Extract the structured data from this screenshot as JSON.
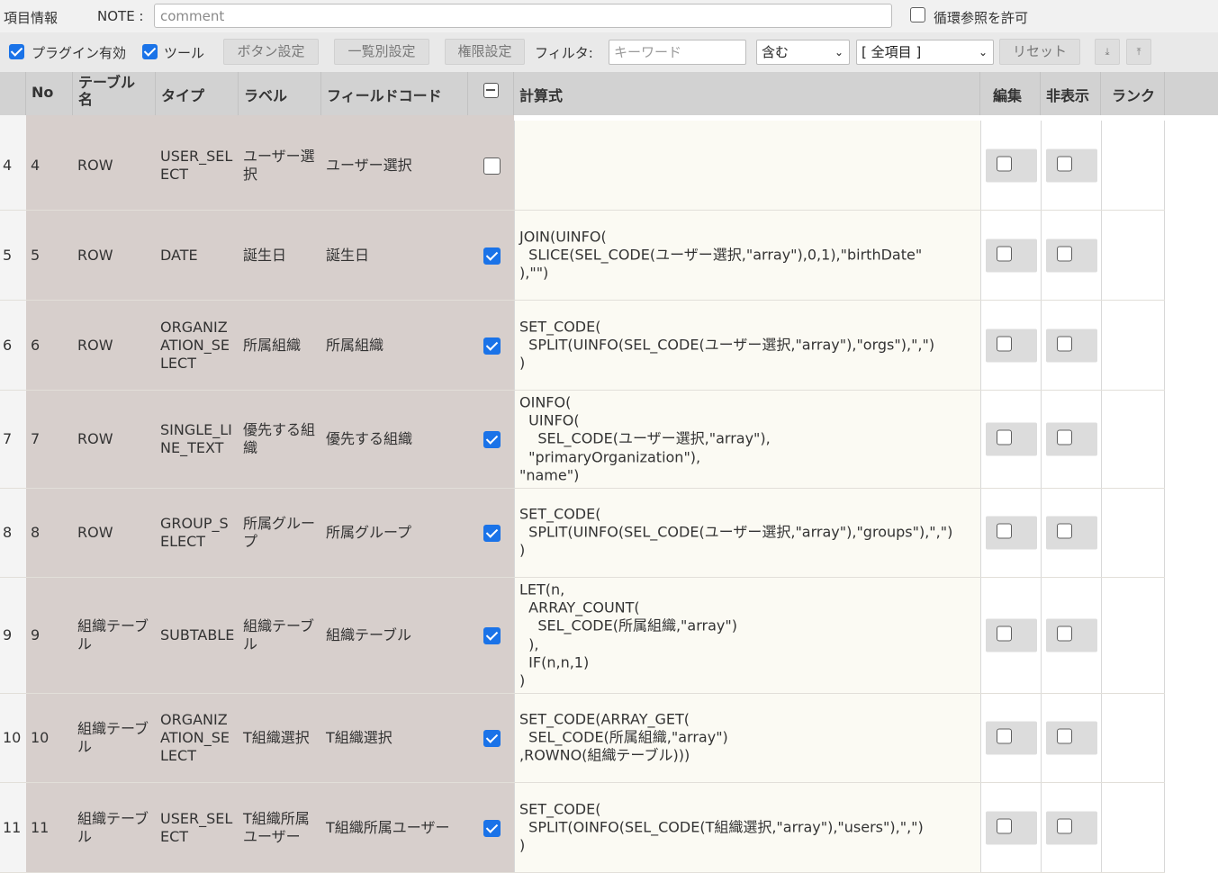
{
  "header": {
    "item_info_label": "項目情報",
    "note_label": "NOTE :",
    "note_placeholder": "comment",
    "circular_ref_label": "循環参照を許可",
    "circular_ref_checked": false
  },
  "toolbar": {
    "plugin_enabled_label": "プラグイン有効",
    "plugin_enabled_checked": true,
    "tools_label": "ツール",
    "tools_checked": true,
    "button_settings": "ボタン設定",
    "list_settings": "一覧別設定",
    "permission_settings": "権限設定",
    "filter_label": "フィルタ:",
    "keyword_placeholder": "キーワード",
    "match_select": "含む",
    "field_select": "[ 全項目 ]",
    "reset": "リセット",
    "icon_download": "download-icon",
    "icon_upload": "upload-icon"
  },
  "columns": {
    "no": "No",
    "table": "テーブル名",
    "table_l1": "テーブル",
    "table_l2": "名",
    "type": "タイプ",
    "label": "ラベル",
    "field_code": "フィールドコード",
    "formula": "計算式",
    "edit": "編集",
    "hidden": "非表示",
    "rank": "ランク"
  },
  "rows": [
    {
      "idx": "4",
      "no": "4",
      "table": "ROW",
      "type": "USER_SELECT",
      "label": "ユーザー選択",
      "field": "ユーザー選択",
      "calc": false,
      "formula": "",
      "edit": false,
      "hidden": false
    },
    {
      "idx": "5",
      "no": "5",
      "table": "ROW",
      "type": "DATE",
      "label": "誕生日",
      "field": "誕生日",
      "calc": true,
      "formula": "JOIN(UINFO(\n  SLICE(SEL_CODE(ユーザー選択,\"array\"),0,1),\"birthDate\"\n),\"\")",
      "edit": false,
      "hidden": false
    },
    {
      "idx": "6",
      "no": "6",
      "table": "ROW",
      "type": "ORGANIZATION_SELECT",
      "label": "所属組織",
      "field": "所属組織",
      "calc": true,
      "formula": "SET_CODE(\n  SPLIT(UINFO(SEL_CODE(ユーザー選択,\"array\"),\"orgs\"),\",\")\n)",
      "edit": false,
      "hidden": false
    },
    {
      "idx": "7",
      "no": "7",
      "table": "ROW",
      "type": "SINGLE_LINE_TEXT",
      "label": "優先する組織",
      "field": "優先する組織",
      "calc": true,
      "formula": "OINFO(\n  UINFO(\n    SEL_CODE(ユーザー選択,\"array\"),\n  \"primaryOrganization\"),\n\"name\")",
      "edit": false,
      "hidden": false
    },
    {
      "idx": "8",
      "no": "8",
      "table": "ROW",
      "type": "GROUP_SELECT",
      "label": "所属グループ",
      "field": "所属グループ",
      "calc": true,
      "formula": "SET_CODE(\n  SPLIT(UINFO(SEL_CODE(ユーザー選択,\"array\"),\"groups\"),\",\")\n)",
      "edit": false,
      "hidden": false
    },
    {
      "idx": "9",
      "no": "9",
      "table": "組織テーブル",
      "type": "SUBTABLE",
      "label": "組織テーブル",
      "field": "組織テーブル",
      "calc": true,
      "formula": "LET(n,\n  ARRAY_COUNT(\n    SEL_CODE(所属組織,\"array\")\n  ),\n  IF(n,n,1)\n)",
      "edit": false,
      "hidden": false
    },
    {
      "idx": "10",
      "no": "10",
      "table": "組織テーブル",
      "type": "ORGANIZATION_SELECT",
      "label": "T組織選択",
      "field": "T組織選択",
      "calc": true,
      "formula": "SET_CODE(ARRAY_GET(\n  SEL_CODE(所属組織,\"array\")\n,ROWNO(組織テーブル)))",
      "edit": false,
      "hidden": false
    },
    {
      "idx": "11",
      "no": "11",
      "table": "組織テーブル",
      "type": "USER_SELECT",
      "label": "T組織所属ユーザー",
      "field": "T組織所属ユーザー",
      "calc": true,
      "formula": "SET_CODE(\n  SPLIT(OINFO(SEL_CODE(T組織選択,\"array\"),\"users\"),\",\")\n)",
      "edit": false,
      "hidden": false
    }
  ]
}
